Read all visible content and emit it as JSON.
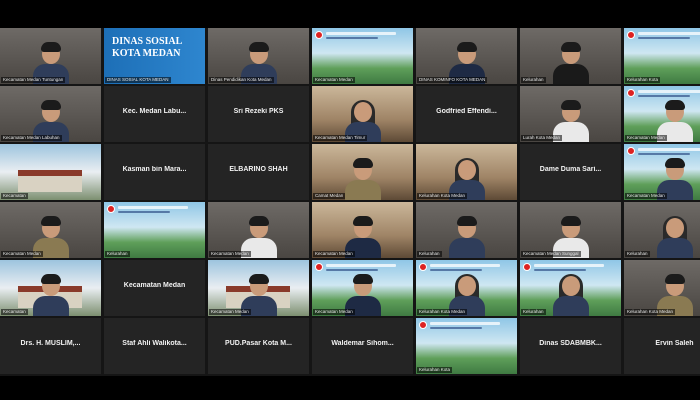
{
  "meeting": {
    "tiles": [
      {
        "name": "Kecamatan Medan Tuntungan",
        "kind": "cam",
        "avatar": "man-dark"
      },
      {
        "name": "DINAS SOSIAL KOTA MEDAN",
        "kind": "dinas",
        "banner_text": "DINAS SOSIAL KOTA MEDAN"
      },
      {
        "name": "Dinas Pendidikan Kota Medan",
        "kind": "cam",
        "avatar": "woman-dark"
      },
      {
        "name": "Kecamatan Medan",
        "kind": "banner"
      },
      {
        "name": "DINAS KOMINFO KOTA MEDAN",
        "kind": "cam",
        "avatar": "man-navy"
      },
      {
        "name": "Kelurahan",
        "kind": "cam",
        "avatar": "man-black"
      },
      {
        "name": "Kelurahan Kota",
        "kind": "banner"
      },
      {
        "name": "Kecamatan Medan Labuhan",
        "kind": "cam",
        "avatar": "man-dark"
      },
      {
        "name": "Kec. Medan Labu...",
        "kind": "blank"
      },
      {
        "name": "Sri Rezeki PKS",
        "kind": "blank"
      },
      {
        "name": "Kecamatan Medan Timur",
        "kind": "office",
        "avatar": "hijab"
      },
      {
        "name": "Godfried Effendi...",
        "kind": "blank"
      },
      {
        "name": "Lurah Kota Medan",
        "kind": "cam",
        "avatar": "woman-white"
      },
      {
        "name": "Kecamatan Medan",
        "kind": "banner",
        "avatar": "man-white"
      },
      {
        "name": "Kecamatan",
        "kind": "building"
      },
      {
        "name": "Kasman bin Mara...",
        "kind": "blank"
      },
      {
        "name": "ELBARINO SHAH",
        "kind": "blank"
      },
      {
        "name": "Camat Medan",
        "kind": "office",
        "avatar": "man-khaki"
      },
      {
        "name": "Kelurahan Kota Medan",
        "kind": "office",
        "avatar": "hijab"
      },
      {
        "name": "Dame Duma Sari...",
        "kind": "blank"
      },
      {
        "name": "Kecamatan Medan",
        "kind": "banner",
        "avatar": "man-dark"
      },
      {
        "name": "Kecamatan Medan",
        "kind": "cam",
        "avatar": "man-khaki"
      },
      {
        "name": "Kelurahan",
        "kind": "banner"
      },
      {
        "name": "Kecamatan Medan",
        "kind": "cam",
        "avatar": "man-white"
      },
      {
        "name": "Kecamatan Medan",
        "kind": "office",
        "avatar": "man-navy"
      },
      {
        "name": "Kelurahan",
        "kind": "cam",
        "avatar": "woman-dark"
      },
      {
        "name": "Kecamatan Medan Sunggal",
        "kind": "cam",
        "avatar": "man-white"
      },
      {
        "name": "Kelurahan",
        "kind": "cam",
        "avatar": "hijab"
      },
      {
        "name": "Kecamatan",
        "kind": "building",
        "avatar": "man-dark"
      },
      {
        "name": "Kecamatan Medan",
        "kind": "blank"
      },
      {
        "name": "Kecamatan Medan",
        "kind": "building",
        "avatar": "man-dark"
      },
      {
        "name": "Kecamatan Medan",
        "kind": "banner",
        "avatar": "man-navy"
      },
      {
        "name": "Kelurahan Kota Medan",
        "kind": "banner",
        "avatar": "hijab"
      },
      {
        "name": "Kelurahan",
        "kind": "banner",
        "avatar": "hijab"
      },
      {
        "name": "Kelurahan Kota Medan",
        "kind": "cam",
        "avatar": "man-khaki"
      },
      {
        "name": "Drs. H. MUSLIM,...",
        "kind": "blank"
      },
      {
        "name": "Staf Ahli Walikota...",
        "kind": "blank"
      },
      {
        "name": "PUD.Pasar Kota M...",
        "kind": "blank"
      },
      {
        "name": "Waldemar Sihom...",
        "kind": "blank"
      },
      {
        "name": "Kelurahan Kota",
        "kind": "banner"
      },
      {
        "name": "Dinas SDABMBK...",
        "kind": "blank"
      },
      {
        "name": "Ervin Saleh",
        "kind": "blank"
      }
    ]
  },
  "colors": {
    "stage": "#151515",
    "blank_tile": "#242424",
    "frame": "#000000"
  }
}
